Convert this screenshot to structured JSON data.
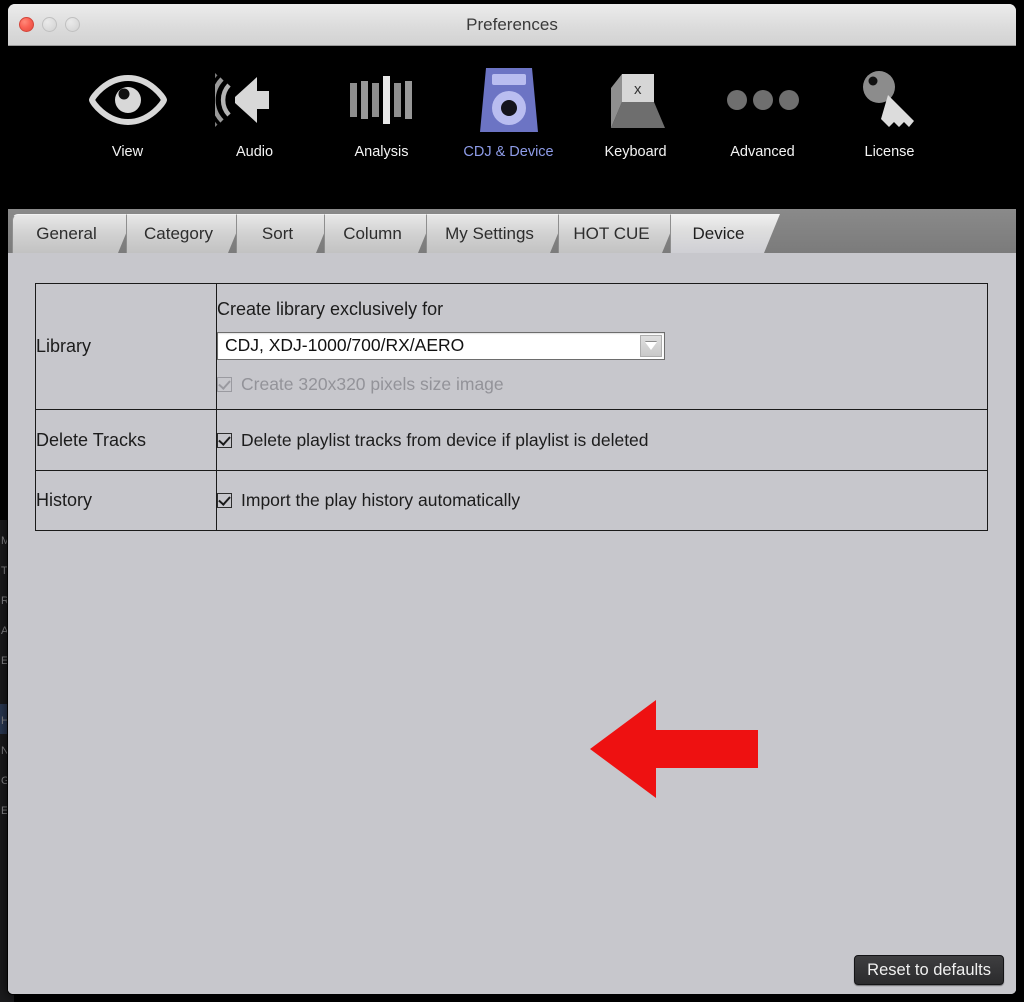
{
  "window": {
    "title": "Preferences",
    "traffic_lights": [
      {
        "name": "close",
        "color": "#fa6255"
      },
      {
        "name": "minimize",
        "color": "#dedede"
      },
      {
        "name": "maximize",
        "color": "#dedede"
      }
    ]
  },
  "toolbar": {
    "items": [
      {
        "label": "View",
        "icon": "eye-icon",
        "selected": false
      },
      {
        "label": "Audio",
        "icon": "speaker-icon",
        "selected": false
      },
      {
        "label": "Analysis",
        "icon": "waveform-icon",
        "selected": false
      },
      {
        "label": "CDJ & Device",
        "icon": "cdj-icon",
        "selected": true
      },
      {
        "label": "Keyboard",
        "icon": "keycap-x-icon",
        "selected": false
      },
      {
        "label": "Advanced",
        "icon": "ellipsis-icon",
        "selected": false
      },
      {
        "label": "License",
        "icon": "key-icon",
        "selected": false
      }
    ],
    "selected_color": "#8e9ce8",
    "background": "#000000"
  },
  "tabs": {
    "items": [
      {
        "label": "General",
        "active": false
      },
      {
        "label": "Category",
        "active": false
      },
      {
        "label": "Sort",
        "active": false
      },
      {
        "label": "Column",
        "active": false
      },
      {
        "label": "My Settings",
        "active": false
      },
      {
        "label": "HOT CUE",
        "active": false
      },
      {
        "label": "Device",
        "active": true
      }
    ]
  },
  "settings": {
    "rows": [
      {
        "label": "Library",
        "field_title": "Create library exclusively for",
        "select": {
          "value": "CDJ, XDJ-1000/700/RX/AERO",
          "options": [
            "CDJ, XDJ-1000/700/RX/AERO"
          ],
          "arrow": "chevron-down-icon"
        },
        "checkbox": {
          "label": "Create 320x320 pixels size image",
          "checked": true,
          "disabled": true
        }
      },
      {
        "label": "Delete Tracks",
        "checkbox": {
          "label": "Delete playlist tracks from device if playlist is deleted",
          "checked": true,
          "disabled": false
        }
      },
      {
        "label": "History",
        "checkbox": {
          "label": "Import the play history automatically",
          "checked": true,
          "disabled": false
        }
      }
    ]
  },
  "annotation": {
    "arrow": {
      "name": "red-pointer-arrow",
      "direction": "left",
      "color": "#ee1111"
    }
  },
  "footer": {
    "reset_label": "Reset to defaults"
  },
  "background_window": {
    "sliver_letters": "M\nT\nR\nA\nE\n \nH\nN\nG\nE"
  }
}
